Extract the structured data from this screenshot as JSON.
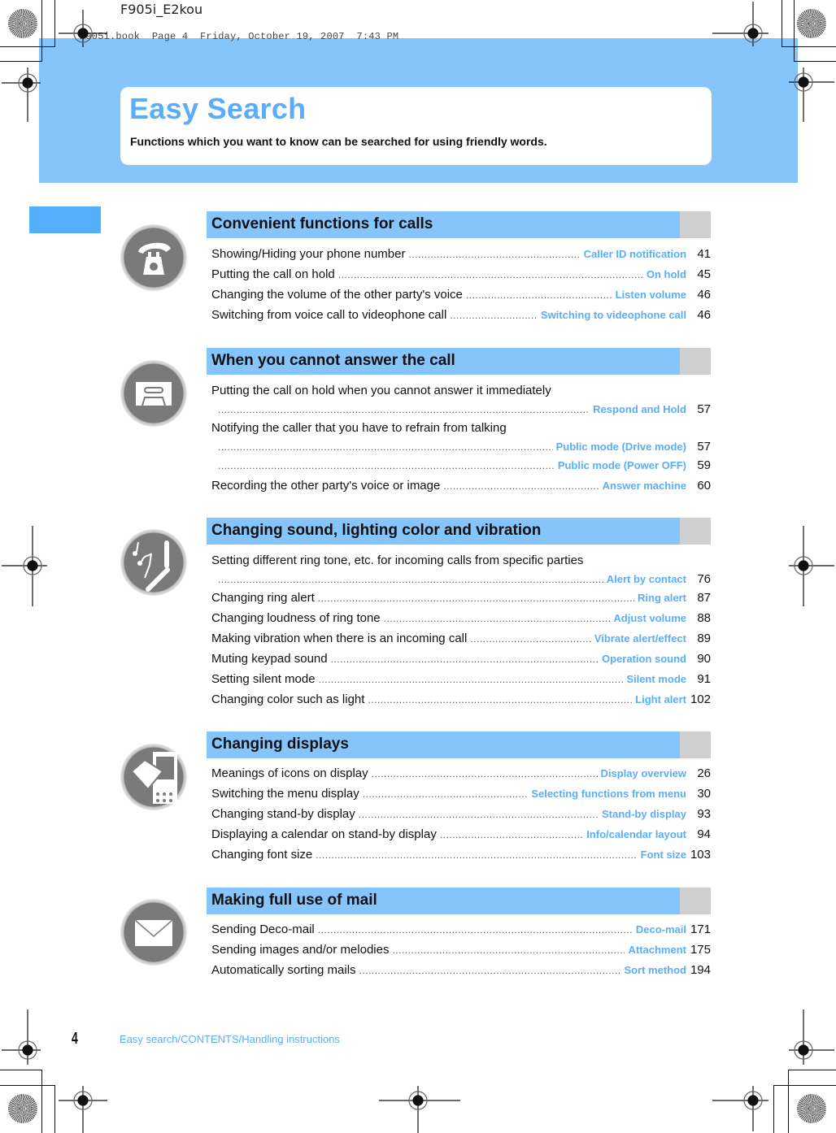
{
  "print_meta": {
    "file_label": "F905i_E2kou",
    "book_info": "F905i.book  Page 4  Friday, October 19, 2007  7:43 PM"
  },
  "header": {
    "title": "Easy Search",
    "subtitle": "Functions which you want to know can be searched for using friendly words."
  },
  "colors": {
    "accent": "#5aaef8",
    "band": "#86c4fc",
    "tab": "#55aefb",
    "cap": "#cfcfcf"
  },
  "sections": [
    {
      "title": "Convenient functions for calls",
      "icon": "telephone-icon",
      "entries": [
        {
          "text": "Showing/Hiding your phone number",
          "ref": "Caller ID notification",
          "page": "41"
        },
        {
          "text": "Putting the call on hold",
          "ref": "On hold",
          "page": "45"
        },
        {
          "text": "Changing the volume of the other party's voice",
          "ref": "Listen volume",
          "page": "46"
        },
        {
          "text": "Switching from voice call to videophone call",
          "ref": "Switching to videophone call",
          "page": "46"
        }
      ]
    },
    {
      "title": "When you cannot answer the call",
      "icon": "cassette-tape-icon",
      "entries": [
        {
          "text": "Putting the call on hold when you cannot answer it immediately",
          "ref": "",
          "page": ""
        },
        {
          "text": "",
          "ref": "Respond and Hold",
          "page": "57"
        },
        {
          "text": "Notifying the caller that you have to refrain from talking",
          "ref": "",
          "page": ""
        },
        {
          "text": "",
          "ref": "Public mode (Drive mode)",
          "page": "57"
        },
        {
          "text": "",
          "ref": "Public mode (Power OFF)",
          "page": "59"
        },
        {
          "text": "Recording the other party's voice or image",
          "ref": "Answer machine",
          "page": "60"
        }
      ]
    },
    {
      "title": "Changing sound, lighting color and vibration",
      "icon": "music-notes-phone-icon",
      "entries": [
        {
          "text": "Setting different ring tone, etc. for incoming calls from specific parties",
          "ref": "",
          "page": ""
        },
        {
          "text": "",
          "ref": "Alert by contact",
          "page": "76"
        },
        {
          "text": "Changing ring alert",
          "ref": "Ring alert",
          "page": "87"
        },
        {
          "text": "Changing loudness of ring tone",
          "ref": "Adjust volume",
          "page": "88"
        },
        {
          "text": "Making vibration when there is an incoming call",
          "ref": "Vibrate alert/effect",
          "page": "89"
        },
        {
          "text": "Muting keypad sound",
          "ref": "Operation sound",
          "page": "90"
        },
        {
          "text": "Setting silent mode",
          "ref": "Silent mode",
          "page": "91"
        },
        {
          "text": "Changing color such as light",
          "ref": "Light alert",
          "page": "102"
        }
      ]
    },
    {
      "title": "Changing displays",
      "icon": "phone-display-icon",
      "entries": [
        {
          "text": "Meanings of icons on display",
          "ref": "Display overview",
          "page": "26"
        },
        {
          "text": "Switching the menu display",
          "ref": "Selecting functions from menu",
          "page": "30"
        },
        {
          "text": "Changing stand-by display",
          "ref": "Stand-by display",
          "page": "93"
        },
        {
          "text": "Displaying a calendar on stand-by display",
          "ref": "Info/calendar layout",
          "page": "94"
        },
        {
          "text": "Changing font size",
          "ref": "Font size",
          "page": "103"
        }
      ]
    },
    {
      "title": "Making full use of mail",
      "icon": "envelope-icon",
      "entries": [
        {
          "text": "Sending Deco-mail",
          "ref": "Deco-mail",
          "page": "171"
        },
        {
          "text": "Sending images and/or melodies",
          "ref": "Attachment",
          "page": "175"
        },
        {
          "text": "Automatically sorting mails",
          "ref": "Sort method",
          "page": "194"
        }
      ]
    }
  ],
  "footer": {
    "page_number": "4",
    "breadcrumb": "Easy search/CONTENTS/Handling instructions"
  }
}
